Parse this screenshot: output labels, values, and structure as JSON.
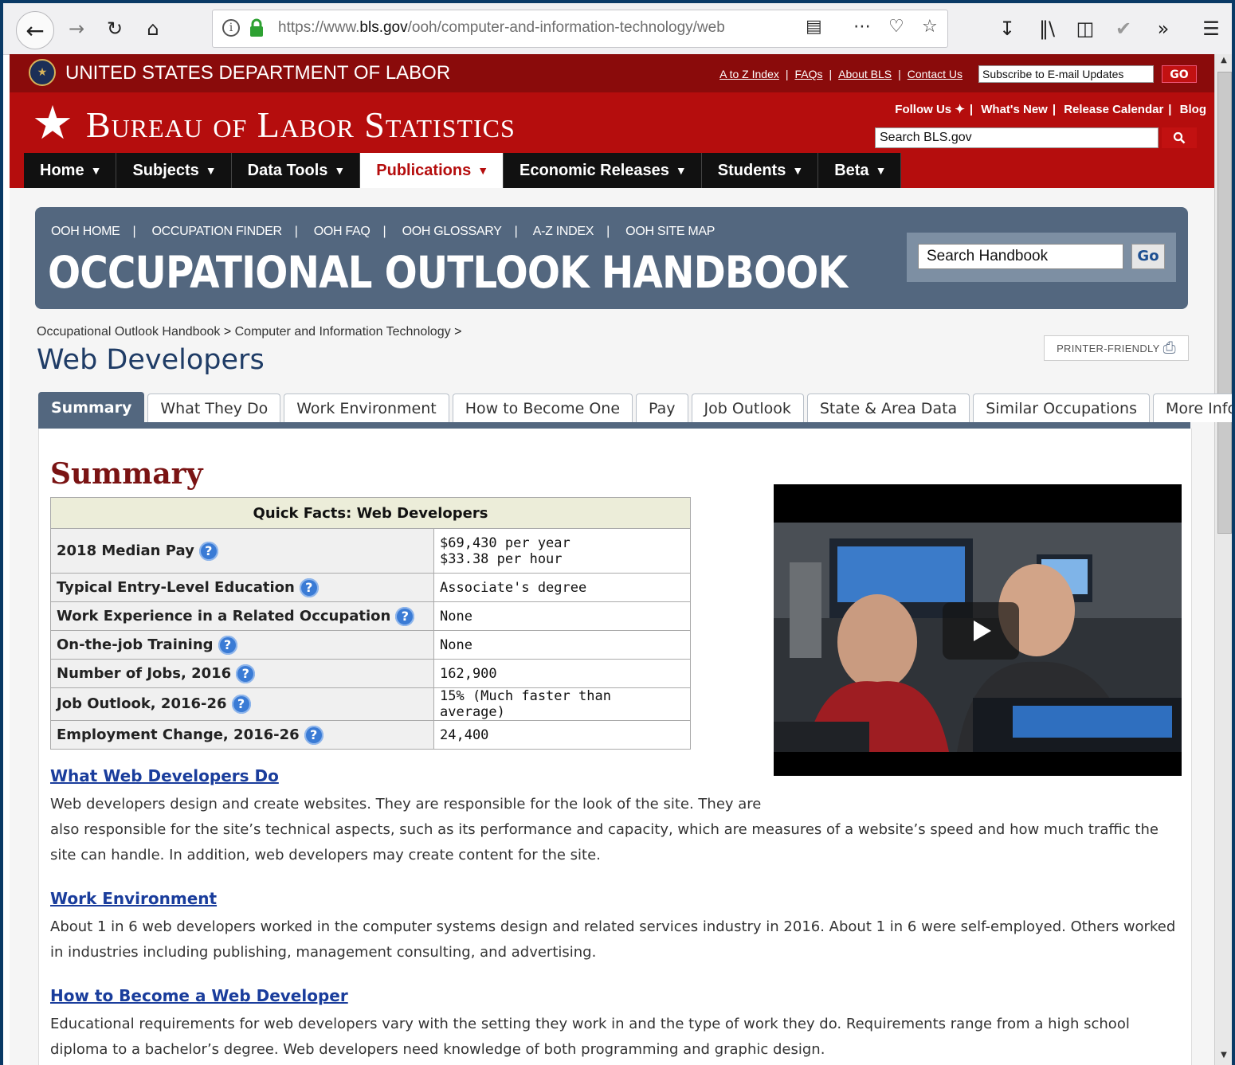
{
  "browser": {
    "url_prefix": "https://www.",
    "url_domain": "bls.gov",
    "url_path": "/ooh/computer-and-information-technology/web"
  },
  "dol": {
    "title": "UNITED STATES DEPARTMENT OF LABOR",
    "links": [
      "A to Z Index",
      "FAQs",
      "About BLS",
      "Contact Us"
    ],
    "subscribe_placeholder": "Subscribe to E-mail Updates",
    "go_label": "GO"
  },
  "bls": {
    "title": "Bureau of Labor Statistics",
    "follow": "Follow Us",
    "whats_new": "What's New",
    "release_calendar": "Release Calendar",
    "blog": "Blog",
    "search_placeholder": "Search BLS.gov",
    "nav": [
      "Home",
      "Subjects",
      "Data Tools",
      "Publications",
      "Economic Releases",
      "Students",
      "Beta"
    ]
  },
  "ooh": {
    "nav": [
      "OOH HOME",
      "OCCUPATION FINDER",
      "OOH FAQ",
      "OOH GLOSSARY",
      "A-Z INDEX",
      "OOH SITE MAP"
    ],
    "title": "OCCUPATIONAL OUTLOOK HANDBOOK",
    "search_placeholder": "Search Handbook",
    "go_label": "Go"
  },
  "breadcrumb": {
    "item1": "Occupational Outlook Handbook",
    "item2": "Computer and Information Technology",
    "sep": ">"
  },
  "page_title": "Web Developers",
  "printer_label": "PRINTER-FRIENDLY",
  "tabs": [
    "Summary",
    "What They Do",
    "Work Environment",
    "How to Become One",
    "Pay",
    "Job Outlook",
    "State & Area Data",
    "Similar Occupations",
    "More Info"
  ],
  "summary_heading": "Summary",
  "quick_facts": {
    "title": "Quick Facts: Web Developers",
    "rows": [
      {
        "label": "2018 Median Pay",
        "value": "$69,430 per year",
        "value2": "$33.38 per hour"
      },
      {
        "label": "Typical Entry-Level Education",
        "value": "Associate's degree"
      },
      {
        "label": "Work Experience in a Related Occupation",
        "value": "None"
      },
      {
        "label": "On-the-job Training",
        "value": "None"
      },
      {
        "label": "Number of Jobs, 2016",
        "value": "162,900"
      },
      {
        "label": "Job Outlook, 2016-26",
        "value": "15% (Much faster than average)"
      },
      {
        "label": "Employment Change, 2016-26",
        "value": "24,400"
      }
    ]
  },
  "sections": [
    {
      "title": "What Web Developers Do",
      "line1": "Web developers design and create websites. They are responsible for the look of the site. They are",
      "line2": "also responsible for the site’s technical aspects, such as its performance and capacity, which are measures of a website’s speed and how much traffic the site can handle. In addition, web developers may create content for the site."
    },
    {
      "title": "Work Environment",
      "text": "About 1 in 6 web developers worked in the computer systems design and related services industry in 2016. About 1 in 6 were self-employed. Others worked in industries including publishing, management consulting, and advertising."
    },
    {
      "title": "How to Become a Web Developer",
      "text": "Educational requirements for web developers vary with the setting they work in and the type of work they do. Requirements range from a high school diploma to a bachelor’s degree. Web developers need knowledge of both programming and graphic design."
    }
  ]
}
